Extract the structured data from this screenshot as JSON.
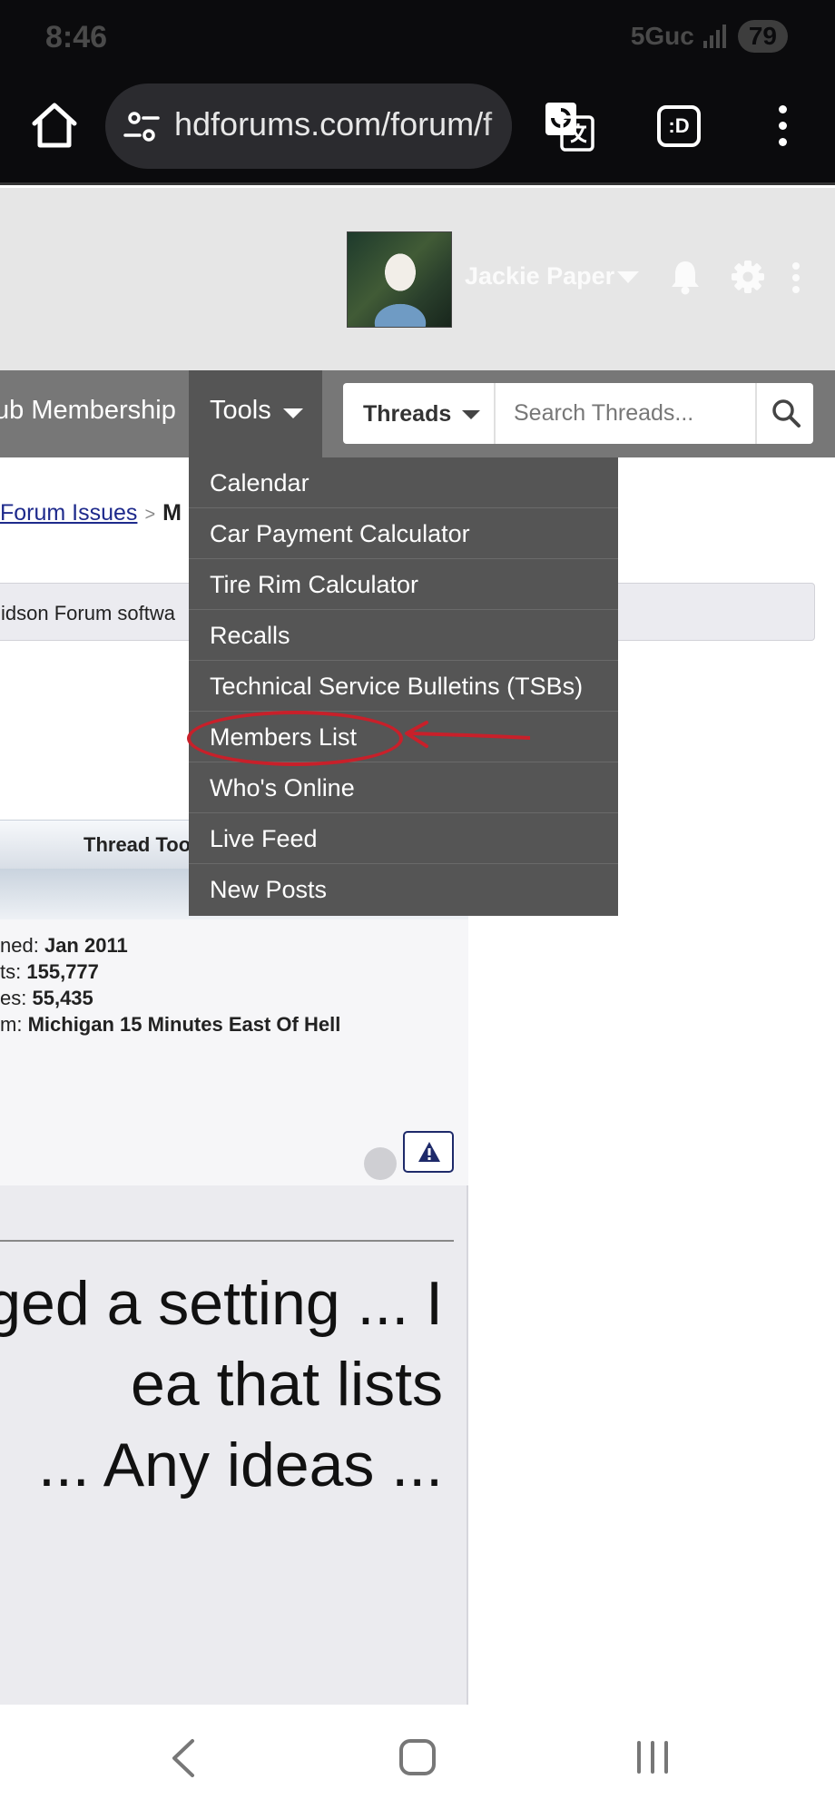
{
  "status_bar": {
    "time": "8:46",
    "network": "5Guc",
    "battery": "79"
  },
  "browser": {
    "url": "hdforums.com/forum/f",
    "extension_label": ":D"
  },
  "header": {
    "username": "Jackie Paper"
  },
  "nav": {
    "membership_label": "ub Membership",
    "tools_label": "Tools",
    "search_scope": "Threads",
    "search_placeholder": "Search Threads..."
  },
  "breadcrumb": {
    "link": "Forum Issues",
    "separator": ">",
    "current": "M"
  },
  "notice": {
    "text": "idson Forum softwa"
  },
  "thread_tools": {
    "label": "Thread Too"
  },
  "user_info": [
    {
      "label": "ned:",
      "value": "Jan 2011"
    },
    {
      "label": "ts:",
      "value": "155,777"
    },
    {
      "label": "es:",
      "value": "55,435"
    },
    {
      "label": "m:",
      "value": "Michigan 15 Minutes East Of Hell"
    }
  ],
  "post": {
    "lines": [
      "ged a setting ... I",
      "ea that lists",
      "... Any ideas ..."
    ]
  },
  "tools_menu": {
    "items": [
      {
        "label": "Calendar"
      },
      {
        "label": "Car Payment Calculator"
      },
      {
        "label": "Tire Rim Calculator"
      },
      {
        "label": "Recalls"
      },
      {
        "label": "Technical Service Bulletins (TSBs)"
      },
      {
        "label": "Members List"
      },
      {
        "label": "Who's Online"
      },
      {
        "label": "Live Feed"
      },
      {
        "label": "New Posts"
      }
    ]
  },
  "colors": {
    "nav_bg": "#777777",
    "dropdown_bg": "#555555",
    "annotation": "#c8202a",
    "header_bg": "#e6e6e6"
  }
}
